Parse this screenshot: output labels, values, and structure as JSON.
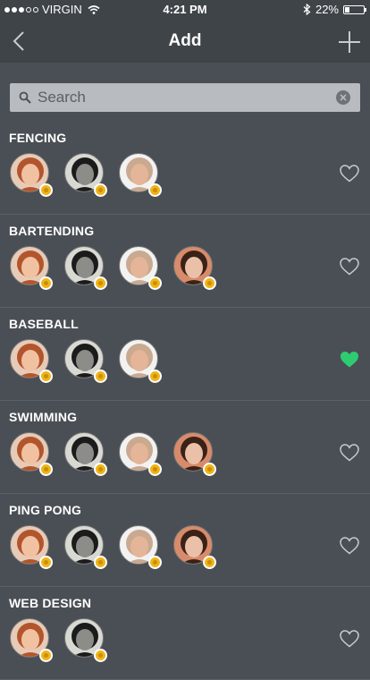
{
  "status": {
    "carrier": "VIRGIN",
    "time": "4:21 PM",
    "battery": "22%",
    "battery_level": 0.22,
    "signal_bars": 3
  },
  "nav": {
    "title": "Add",
    "back_icon": "chevron-left-icon",
    "add_icon": "plus-icon"
  },
  "search": {
    "placeholder": "Search"
  },
  "colors": {
    "nav_bg": "#3f4449",
    "body_bg": "#4a4f55",
    "liked": "#2ecc71",
    "badge": "#f0b418"
  },
  "sections": [
    {
      "title": "FENCING",
      "avatars": [
        "woman-redhead",
        "man-bw",
        "man-bald"
      ],
      "liked": false
    },
    {
      "title": "BARTENDING",
      "avatars": [
        "woman-redhead",
        "man-bw",
        "man-bald",
        "woman-brunette"
      ],
      "liked": false
    },
    {
      "title": "BASEBALL",
      "avatars": [
        "woman-redhead",
        "man-bw",
        "man-bald"
      ],
      "liked": true
    },
    {
      "title": "SWIMMING",
      "avatars": [
        "woman-redhead",
        "man-bw",
        "man-bald",
        "woman-brunette"
      ],
      "liked": false
    },
    {
      "title": "PING PONG",
      "avatars": [
        "woman-redhead",
        "man-bw",
        "man-bald",
        "woman-brunette"
      ],
      "liked": false
    },
    {
      "title": "WEB DESIGN",
      "avatars": [
        "woman-redhead",
        "man-bw"
      ],
      "liked": false
    }
  ]
}
